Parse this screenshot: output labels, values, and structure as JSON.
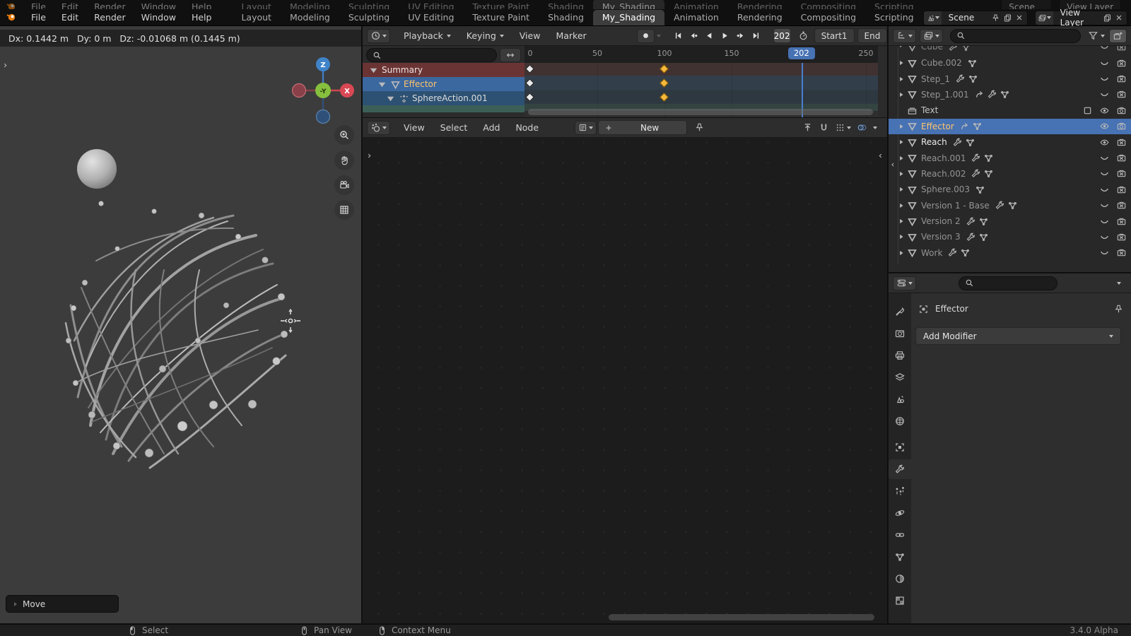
{
  "app": {
    "version": "3.4.0 Alpha"
  },
  "topbar": {
    "menus": [
      "File",
      "Edit",
      "Render",
      "Window",
      "Help"
    ],
    "tabs": [
      {
        "label": "Layout"
      },
      {
        "label": "Modeling"
      },
      {
        "label": "Sculpting"
      },
      {
        "label": "UV Editing"
      },
      {
        "label": "Texture Paint"
      },
      {
        "label": "Shading"
      },
      {
        "label": "My_Shading",
        "cls": "active"
      },
      {
        "label": "Animation"
      },
      {
        "label": "Rendering"
      },
      {
        "label": "Compositing"
      },
      {
        "label": "Scripting"
      }
    ],
    "scene": {
      "label": "Scene"
    },
    "view_layer": {
      "label": "View Layer"
    }
  },
  "viewport": {
    "transform_status": "Dx: 0.1442 m   Dy: 0 m   Dz: -0.01068 m (0.1445 m)",
    "gizmo": {
      "up": "Z",
      "right": "X",
      "center": "-Y"
    },
    "operator_panel": "Move"
  },
  "dopesheet": {
    "menus": [
      {
        "label": "Playback",
        "dd": true
      },
      {
        "label": "Keying",
        "dd": true
      },
      {
        "label": "View"
      },
      {
        "label": "Marker"
      }
    ],
    "transport": [
      {
        "icon": "jumpstart"
      },
      {
        "icon": "keyprev"
      },
      {
        "icon": "playrev"
      },
      {
        "icon": "play"
      },
      {
        "icon": "keynext"
      },
      {
        "icon": "jumpend"
      }
    ],
    "current_frame": "202",
    "start_label": "Start",
    "start_value": "1",
    "end_label": "End",
    "ruler_ticks": [
      {
        "f": 0,
        "label": "0"
      },
      {
        "f": 50,
        "label": "50"
      },
      {
        "f": 100,
        "label": "100"
      },
      {
        "f": 150,
        "label": "150"
      },
      {
        "f": 250,
        "label": "250"
      }
    ],
    "playhead": {
      "frame": 202,
      "label": "202"
    },
    "channels": [
      {
        "name": "Summary",
        "cls": "ch-summary",
        "icons": [
          "tri-d|c-white"
        ],
        "band": "rgba(109,58,58,0.30)",
        "keys": [
          {
            "f": 0
          },
          {
            "f": 100,
            "sel": true
          }
        ]
      },
      {
        "name": "Effector",
        "cls": "ch-effector",
        "icons": [
          "tri-d|c-white",
          "mesh-obj|c-white"
        ],
        "band": "rgba(61,106,150,0.28)",
        "keys": [
          {
            "f": 0
          },
          {
            "f": 100,
            "sel": true
          }
        ]
      },
      {
        "name": "SphereAction.001",
        "cls": "ch-action",
        "icons": [
          "tri-d|c-white",
          "action|c-white"
        ],
        "band": "rgba(45,81,115,0.28)",
        "keys": [
          {
            "f": 0
          },
          {
            "f": 100,
            "sel": true
          }
        ]
      },
      {
        "name": "",
        "cls": "ch-partial",
        "icons": [],
        "band": "rgba(60,95,88,0.45)",
        "keys": []
      }
    ],
    "colors": {
      "playhead": "#4772b3",
      "key_selected": "#f6b93c",
      "key_normal": "#e9e9e9"
    }
  },
  "node_editor": {
    "menus": [
      {
        "label": "View"
      },
      {
        "label": "Select"
      },
      {
        "label": "Add"
      },
      {
        "label": "Node"
      }
    ],
    "new_button": "New"
  },
  "outliner": {
    "rows": [
      {
        "disc": "tri-r",
        "icon": "mesh-obj|c-orange",
        "name": "Cube",
        "mids": [
          "wrench|c-wrench",
          "mesh-data|c-green"
        ],
        "rights": [
          "eye-closed|c-gray",
          "camera-off|c-gray"
        ],
        "cls": "rdim clip"
      },
      {
        "disc": "tri-r",
        "icon": "mesh-obj|c-orange",
        "name": "Cube.002",
        "mids": [
          "mesh-data|c-green"
        ],
        "rights": [
          "eye-closed|c-gray",
          "camera-off|c-gray"
        ],
        "cls": "rdim"
      },
      {
        "disc": "tri-r",
        "icon": "mesh-obj|c-orange",
        "name": "Step_1",
        "mids": [
          "wrench|c-wrench",
          "mesh-data|c-green"
        ],
        "rights": [
          "eye-closed|c-gray",
          "camera-off|c-gray"
        ],
        "cls": "rdim"
      },
      {
        "disc": "tri-r",
        "icon": "mesh-obj|c-orange",
        "name": "Step_1.001",
        "mids": [
          "constraint|c-constraint",
          "wrench|c-wrench",
          "mesh-data|c-green"
        ],
        "rights": [
          "eye-closed|c-gray",
          "camera-off|c-gray"
        ],
        "cls": "rdim"
      },
      {
        "disc": "",
        "icon": "collection|c-gray",
        "name": "Text",
        "mids": [],
        "rights": [
          "checkbox|c-gray",
          "eye-open|c-white",
          "camera-on|c-white"
        ],
        "cls": "coll"
      },
      {
        "disc": "tri-r",
        "icon": "mesh-obj|c-orange",
        "name": "Effector",
        "mids": [
          "constraint|c-white",
          "mesh-data|c-teal"
        ],
        "rights": [
          "eye-open|c-white",
          "camera-on|c-white"
        ],
        "cls": "selected"
      },
      {
        "disc": "tri-r",
        "icon": "mesh-obj|c-orange",
        "name": "Reach",
        "mids": [
          "wrench|c-wrench",
          "mesh-data|c-green"
        ],
        "rights": [
          "eye-open|c-white",
          "camera-off|c-gray"
        ],
        "cls": "lit"
      },
      {
        "disc": "tri-r",
        "icon": "mesh-obj|c-orange",
        "name": "Reach.001",
        "mids": [
          "wrench|c-wrench",
          "mesh-data|c-green"
        ],
        "rights": [
          "eye-closed|c-gray",
          "camera-off|c-gray"
        ],
        "cls": "rdim"
      },
      {
        "disc": "tri-r",
        "icon": "mesh-obj|c-orange",
        "name": "Reach.002",
        "mids": [
          "wrench|c-wrench",
          "mesh-data|c-green"
        ],
        "rights": [
          "eye-closed|c-gray",
          "camera-off|c-gray"
        ],
        "cls": "rdim"
      },
      {
        "disc": "tri-r",
        "icon": "mesh-obj|c-orange",
        "name": "Sphere.003",
        "mids": [
          "mesh-data|c-green"
        ],
        "rights": [
          "eye-closed|c-gray",
          "camera-off|c-gray"
        ],
        "cls": "rdim"
      },
      {
        "disc": "tri-r",
        "icon": "mesh-obj|c-orange",
        "name": "Version 1 - Base",
        "mids": [
          "wrench|c-wrench",
          "mesh-data|c-green"
        ],
        "rights": [
          "eye-closed|c-gray",
          "camera-off|c-gray"
        ],
        "cls": "rdim"
      },
      {
        "disc": "tri-r",
        "icon": "mesh-obj|c-orange",
        "name": "Version 2",
        "mids": [
          "wrench|c-wrench",
          "mesh-data|c-green"
        ],
        "rights": [
          "eye-closed|c-gray",
          "camera-off|c-gray"
        ],
        "cls": "rdim"
      },
      {
        "disc": "tri-r",
        "icon": "mesh-obj|c-orange",
        "name": "Version 3",
        "mids": [
          "wrench|c-wrench",
          "mesh-data|c-green"
        ],
        "rights": [
          "eye-closed|c-gray",
          "camera-off|c-gray"
        ],
        "cls": "rdim"
      },
      {
        "disc": "tri-r",
        "icon": "mesh-obj|c-orange",
        "name": "Work",
        "mids": [
          "wrench|c-wrench",
          "mesh-data|c-green"
        ],
        "rights": [
          "eye-closed|c-gray",
          "camera-off|c-gray"
        ],
        "cls": "rdim"
      }
    ]
  },
  "properties": {
    "breadcrumb": {
      "label": "Effector"
    },
    "add_modifier_label": "Add Modifier",
    "tabs": [
      {
        "icon": "tool|c-gray",
        "name": "tool"
      },
      {
        "icon": "render|c-gray",
        "name": "render"
      },
      {
        "icon": "output|c-gray",
        "name": "output"
      },
      {
        "icon": "viewlayer|c-gray",
        "name": "view-layer"
      },
      {
        "icon": "scene|c-gray",
        "name": "scene"
      },
      {
        "icon": "world|c-world",
        "name": "world"
      },
      {
        "icon": "object|c-orange",
        "name": "object"
      },
      {
        "icon": "wrench|c-mod",
        "name": "modifiers",
        "active": true
      },
      {
        "icon": "particles|c-phys",
        "name": "particles"
      },
      {
        "icon": "physics|c-phys",
        "name": "physics"
      },
      {
        "icon": "constraints|c-phys",
        "name": "constraints"
      },
      {
        "icon": "mesh-data|c-data",
        "name": "object-data"
      },
      {
        "icon": "material|c-mat",
        "name": "material"
      },
      {
        "icon": "texture|c-tex",
        "name": "texture"
      }
    ]
  },
  "statusbar": {
    "items": [
      {
        "icon": "mouse-l",
        "label": "Select"
      },
      {
        "icon": "mouse-m",
        "label": "Pan View"
      },
      {
        "icon": "mouse-r",
        "label": "Context Menu"
      }
    ],
    "version": "3.4.0 Alpha"
  }
}
